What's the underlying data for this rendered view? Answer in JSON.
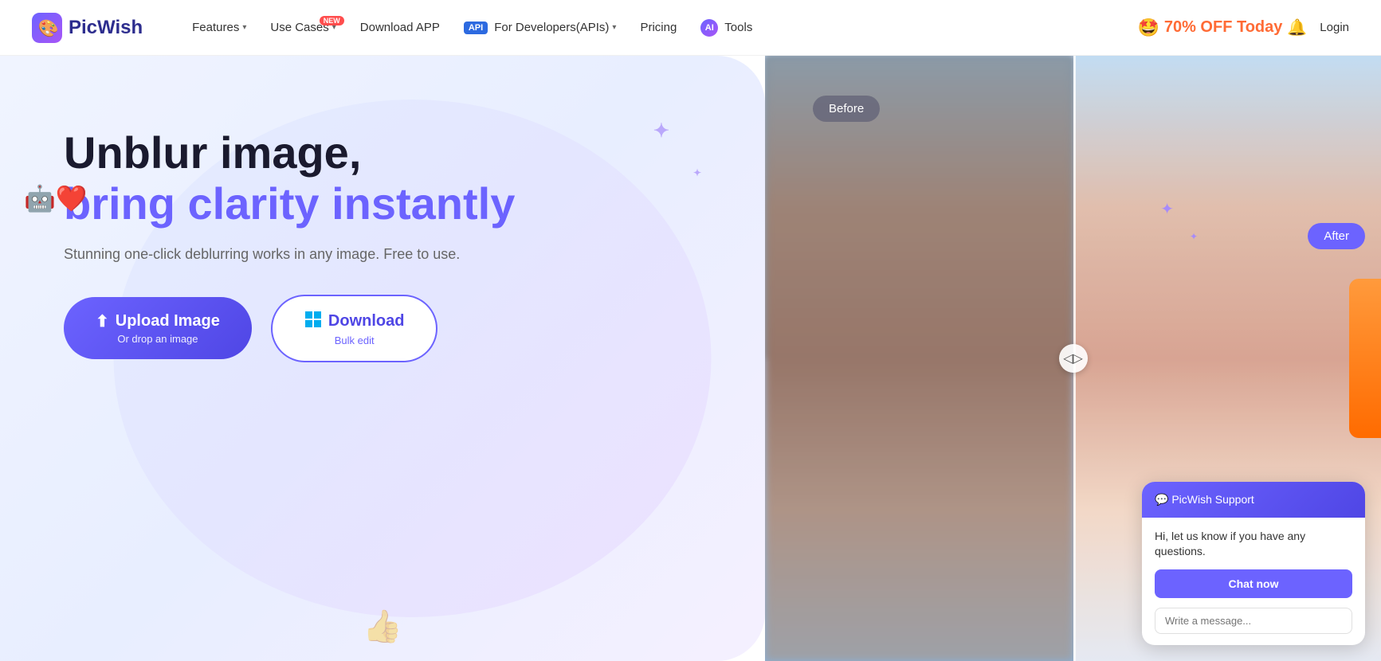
{
  "brand": {
    "name": "PicWish",
    "logo_text": "PicWish"
  },
  "navbar": {
    "links": [
      {
        "id": "features",
        "label": "Features",
        "has_dropdown": true,
        "badge": null
      },
      {
        "id": "use-cases",
        "label": "Use Cases",
        "has_dropdown": true,
        "badge": "NEW"
      },
      {
        "id": "download-app",
        "label": "Download APP",
        "has_dropdown": false,
        "badge": null
      },
      {
        "id": "for-developers",
        "label": "For Developers(APIs)",
        "has_dropdown": true,
        "badge": null,
        "prefix": "API"
      },
      {
        "id": "pricing",
        "label": "Pricing",
        "has_dropdown": false,
        "badge": null
      },
      {
        "id": "tools",
        "label": "Tools",
        "has_dropdown": false,
        "badge": null,
        "prefix": "AI"
      }
    ],
    "promo": {
      "emoji": "🤩",
      "text": "70% OFF Today",
      "notification_emoji": "🔔"
    },
    "login": "Login"
  },
  "hero": {
    "title_dark": "Unblur image,",
    "title_blue": "bring clarity instantly",
    "subtitle": "Stunning one-click deblurring works in any image. Free to use.",
    "upload_btn_main": "Upload Image",
    "upload_btn_sub": "Or drop an image",
    "download_btn_main": "Download",
    "download_btn_sub": "Bulk edit"
  },
  "before_after": {
    "before_label": "Before",
    "after_label": "After"
  },
  "chat": {
    "greeting": "Hi, let us know if you have any questions.",
    "chat_now": "Chat now",
    "input_placeholder": "Write a message..."
  }
}
